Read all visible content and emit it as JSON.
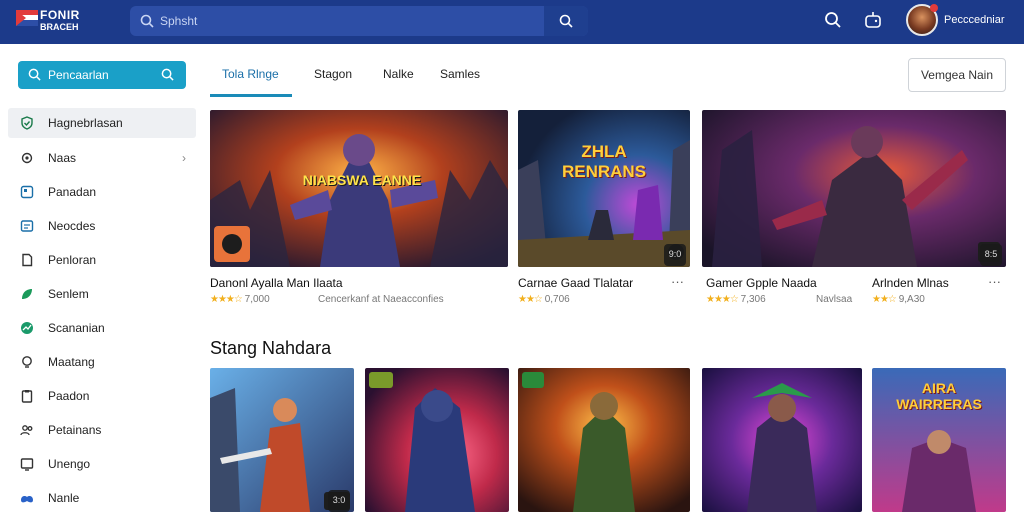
{
  "header": {
    "logo_line1": "FONIR",
    "logo_line2": "BRACEH",
    "search_placeholder": "Sphsht",
    "username": "Pecccedniar"
  },
  "sidebar": {
    "search_label": "Pencaarlan",
    "items": [
      {
        "label": "Hagnebrlasan",
        "icon": "shield-check-icon"
      },
      {
        "label": "Naas",
        "icon": "gear-icon"
      },
      {
        "label": "Panadan",
        "icon": "square-icon"
      },
      {
        "label": "Neocdes",
        "icon": "image-icon"
      },
      {
        "label": "Penloran",
        "icon": "document-icon"
      },
      {
        "label": "Senlem",
        "icon": "leaf-icon"
      },
      {
        "label": "Scananian",
        "icon": "chart-icon"
      },
      {
        "label": "Maatang",
        "icon": "bulb-icon"
      },
      {
        "label": "Paadon",
        "icon": "clipboard-icon"
      },
      {
        "label": "Petainans",
        "icon": "people-icon"
      },
      {
        "label": "Unengo",
        "icon": "screen-icon"
      },
      {
        "label": "Nanle",
        "icon": "gamepad-icon"
      }
    ]
  },
  "tabs": [
    "Tola Rlnge",
    "Stagon",
    "Nalke",
    "Samles"
  ],
  "view_button": "Vemgea Nain",
  "featured": [
    {
      "title": "Danonl Ayalla Man Ilaata",
      "rating": "7,000",
      "extra": "Cencerkanf at Naeacconfies",
      "art_text": "NIABSWA EANNE"
    },
    {
      "title": "Carnae Gaad Tlalatar",
      "rating": "0,706",
      "extra": "",
      "art_text": "ZHLA RENRANS"
    },
    {
      "title": "Gamer Gpple Naada",
      "rating": "7,306",
      "extra": "Navlsaa",
      "art_text": ""
    },
    {
      "title": "Arlnden Mlnas",
      "rating": "9,A30",
      "extra": "",
      "art_text": ""
    }
  ],
  "section_title": "Stang Nahdara",
  "row2_art_text": "AIRA WAIRRERAS",
  "badges": [
    "9:0",
    "8:5",
    "3:0"
  ],
  "colors": {
    "topbar": "#1c3a8a",
    "accent": "#1aa0c8",
    "star": "#f2b01e"
  }
}
